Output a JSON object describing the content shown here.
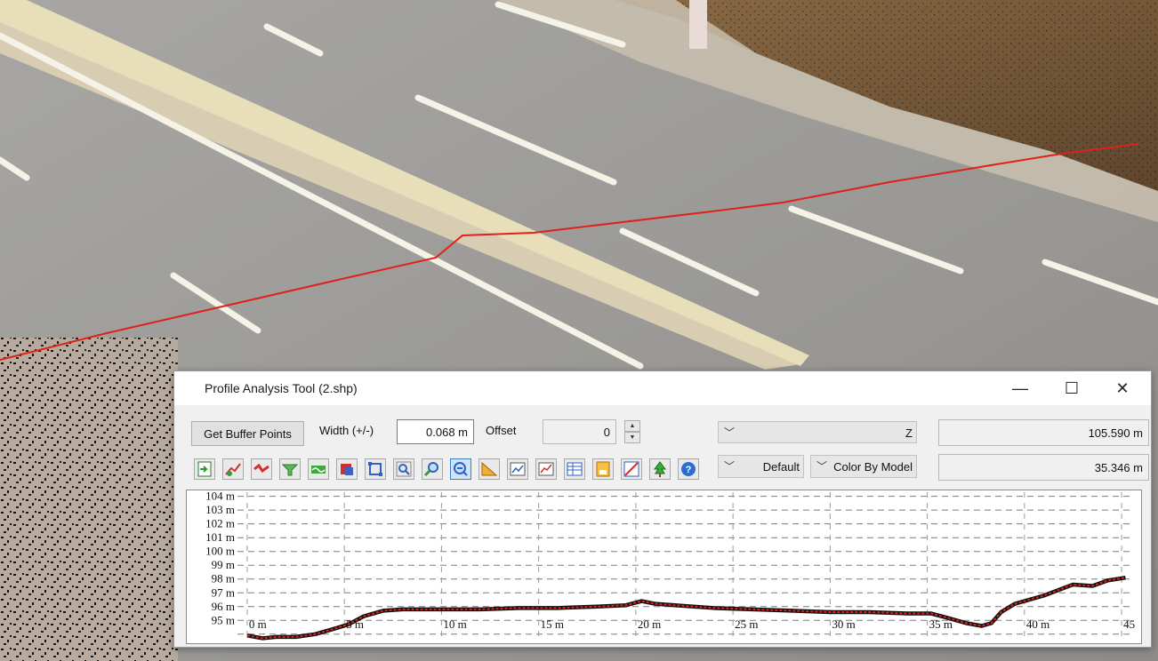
{
  "window": {
    "title": "Profile Analysis Tool (2.shp)",
    "minimize_glyph": "—",
    "maximize_glyph": "☐",
    "close_glyph": "✕"
  },
  "controls": {
    "get_buffer_label": "Get Buffer Points",
    "width_label": "Width (+/-)",
    "width_value": "0.068 m",
    "offset_label": "Offset",
    "offset_value": "0",
    "spin_up": "▲",
    "spin_down": "▼",
    "axis_select": "Z",
    "axis_value": "105.590 m",
    "style_select": "Default",
    "color_select": "Color By Model",
    "second_value": "35.346 m"
  },
  "toolbar_icons": [
    "import-icon",
    "pick-profile-icon",
    "remove-points-icon",
    "filter-icon",
    "smooth-icon",
    "delete-icon",
    "select-rect-icon",
    "zoom-extent-icon",
    "zoom-in-icon",
    "zoom-window-icon",
    "measure-angle-icon",
    "export-image-icon",
    "chart-icon",
    "table-icon",
    "save-icon",
    "slope-icon",
    "tree-icon",
    "help-icon"
  ],
  "colors": {
    "accent": "#3b7fc4",
    "profile_line": "#e0201a",
    "profile_dots": "#111111"
  },
  "chart_data": {
    "type": "line",
    "y_tick_labels": [
      "95 m",
      "96 m",
      "97 m",
      "98 m",
      "99 m",
      "100 m",
      "101 m",
      "102 m",
      "103 m",
      "104 m"
    ],
    "x_tick_labels": [
      "0 m",
      "5 m",
      "10 m",
      "15 m",
      "20 m",
      "25 m",
      "30 m",
      "35 m",
      "40 m",
      "45"
    ],
    "xlim": [
      -0.5,
      45.5
    ],
    "ylim": [
      93.6,
      104.3
    ],
    "grid": true,
    "series": [
      {
        "x": [
          0,
          0.8,
          1.5,
          2.5,
          3.5,
          4.5,
          5.2,
          6,
          7,
          8,
          9,
          10,
          12,
          14,
          16,
          18,
          19.5,
          20.3,
          21,
          22,
          24,
          26,
          28,
          30,
          32,
          34,
          35.2,
          36,
          37,
          37.8,
          38.3,
          38.8,
          39.5,
          41,
          42.5,
          43.5,
          44.3,
          45.2
        ],
        "y": [
          93.9,
          93.7,
          93.8,
          93.8,
          94.0,
          94.4,
          94.7,
          95.3,
          95.7,
          95.8,
          95.8,
          95.8,
          95.8,
          95.9,
          95.9,
          96.0,
          96.1,
          96.4,
          96.2,
          96.1,
          95.9,
          95.8,
          95.7,
          95.6,
          95.6,
          95.5,
          95.5,
          95.2,
          94.8,
          94.6,
          94.8,
          95.6,
          96.2,
          96.8,
          97.6,
          97.5,
          97.9,
          98.1
        ]
      }
    ]
  }
}
